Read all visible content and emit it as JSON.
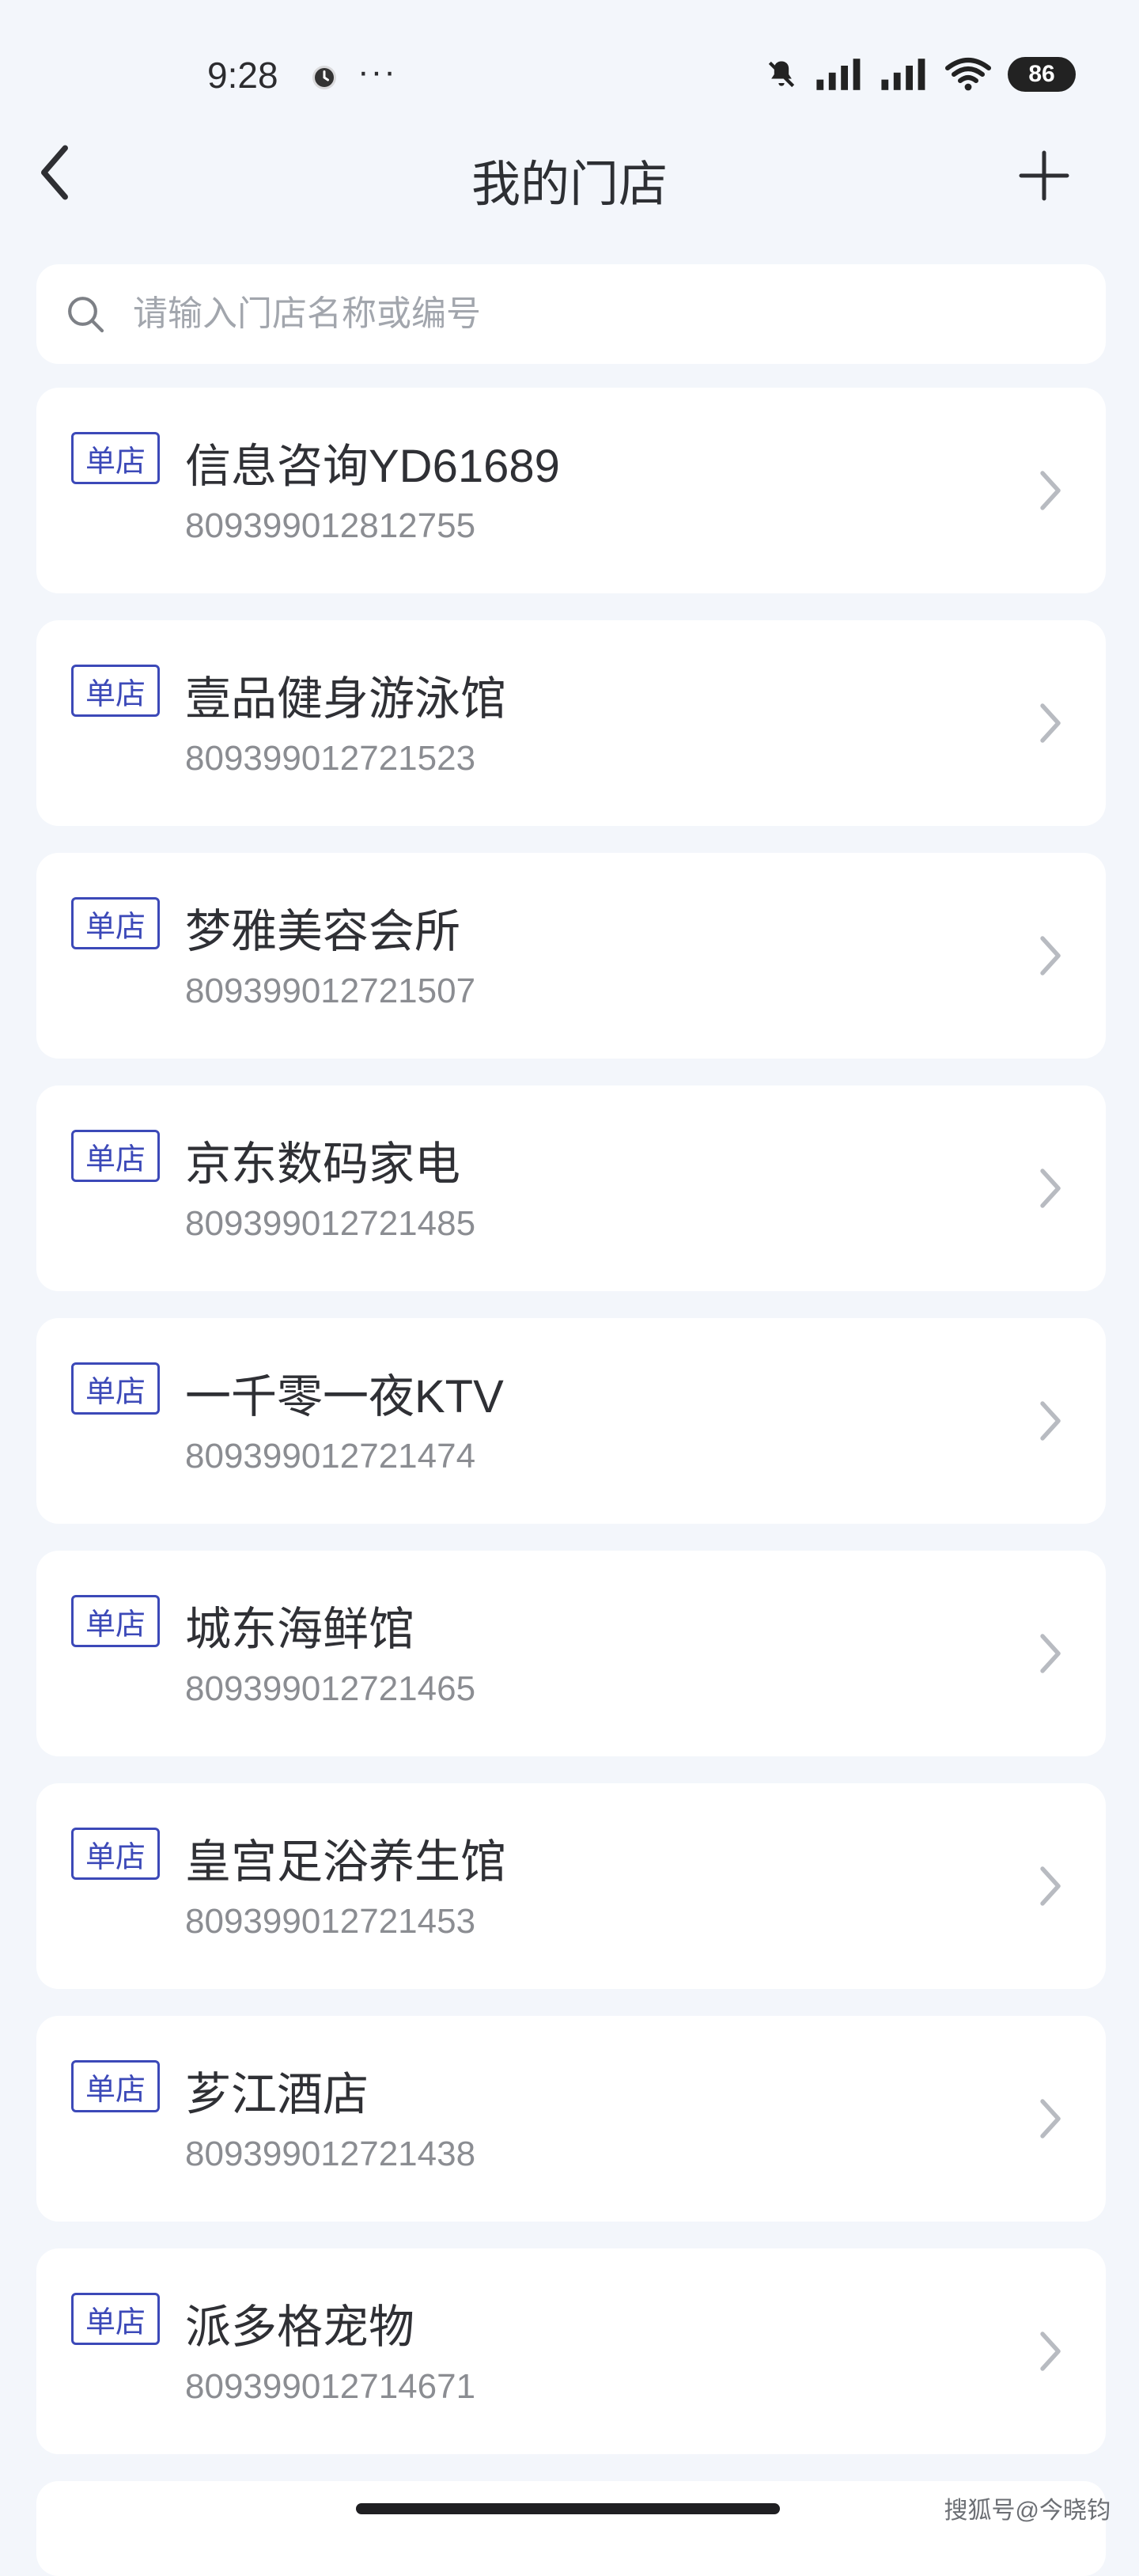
{
  "status_bar": {
    "time": "9:28",
    "dots": "···",
    "battery": "86",
    "icons": [
      "clock-icon",
      "mute-icon",
      "signal-icon",
      "signal-icon",
      "wifi-icon"
    ]
  },
  "nav": {
    "title": "我的门店",
    "back_icon": "chevron-left-icon",
    "add_icon": "plus-icon"
  },
  "search": {
    "placeholder": "请输入门店名称或编号",
    "value": ""
  },
  "stores": [
    {
      "tag": "单店",
      "name": "信息咨询YD61689",
      "code": "809399012812755"
    },
    {
      "tag": "单店",
      "name": "壹品健身游泳馆",
      "code": "809399012721523"
    },
    {
      "tag": "单店",
      "name": "梦雅美容会所",
      "code": "809399012721507"
    },
    {
      "tag": "单店",
      "name": "京东数码家电",
      "code": "809399012721485"
    },
    {
      "tag": "单店",
      "name": "一千零一夜KTV",
      "code": "809399012721474"
    },
    {
      "tag": "单店",
      "name": "城东海鲜馆",
      "code": "809399012721465"
    },
    {
      "tag": "单店",
      "name": "皇宫足浴养生馆",
      "code": "809399012721453"
    },
    {
      "tag": "单店",
      "name": "芗江酒店",
      "code": "809399012721438"
    },
    {
      "tag": "单店",
      "name": "派多格宠物",
      "code": "809399012714671"
    }
  ],
  "watermark": "搜狐号@今晓钧",
  "colors": {
    "background": "#f3f6fb",
    "tag": "#3c49b8",
    "name": "#2f3035",
    "code": "#8b8d92"
  }
}
